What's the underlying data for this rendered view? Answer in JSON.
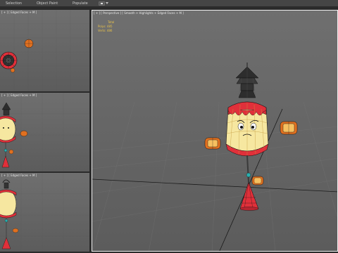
{
  "menubar": {
    "items": [
      "Selection",
      "Object Paint",
      "Populate"
    ]
  },
  "viewports": {
    "top": {
      "header": "[ + ] [ Edged Faces + M ]"
    },
    "left": {
      "header": "[ + ] [ Edged Faces + M ]"
    },
    "front": {
      "header": "[ + ] [ Edged Faces + M ]"
    },
    "perspective": {
      "header": "[ + ] [ Perspective ] [ Smooth + Highlights + Edged Faces + M ]",
      "stats": {
        "label": "Total",
        "polys": "Polys: 485",
        "verts": "Verts: 486"
      }
    }
  },
  "colors": {
    "lantern_red": "#e0303a",
    "lantern_cream": "#f6e7a0",
    "lantern_orange": "#e07020",
    "roof_dark": "#2d2d2d",
    "stats_text": "#e8c24a",
    "selection_border": "#f0f0f0"
  }
}
